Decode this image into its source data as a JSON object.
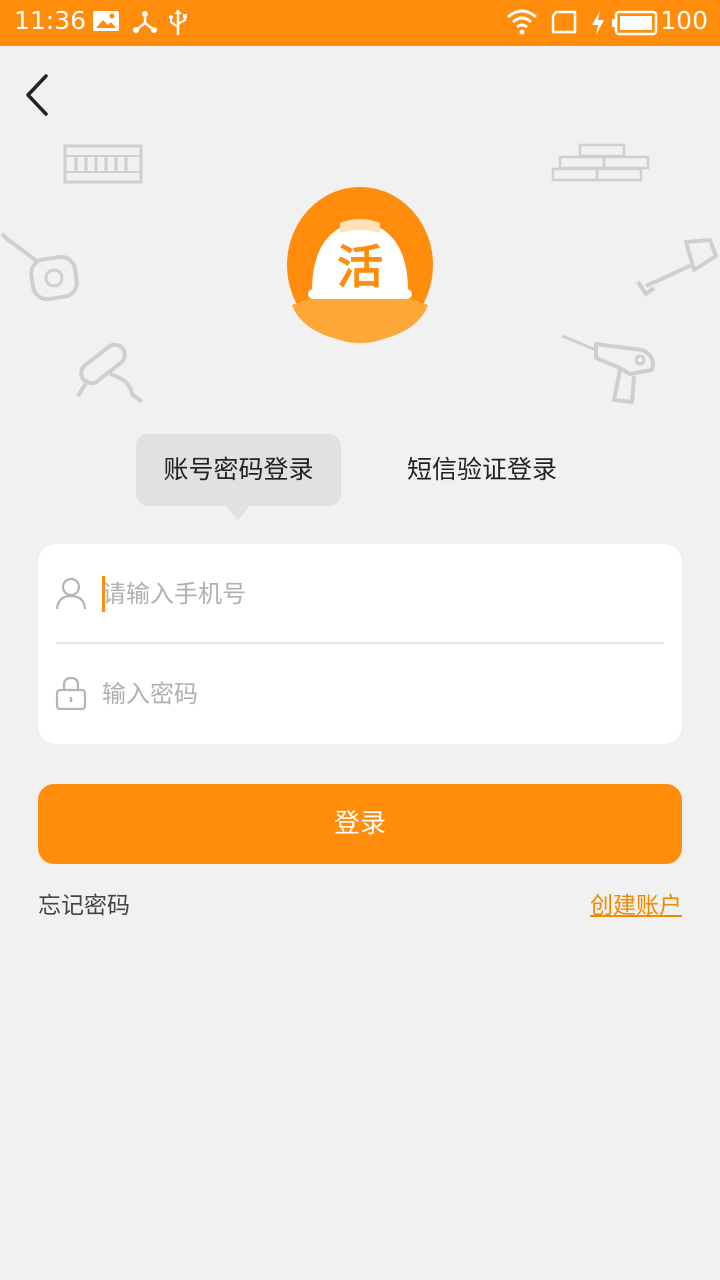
{
  "status_bar": {
    "time": "11:36",
    "battery_level": "100",
    "icons": [
      "image-icon",
      "share-icon",
      "usb-icon",
      "wifi-icon",
      "sim-icon",
      "charging-icon",
      "battery-icon"
    ]
  },
  "header": {
    "back_icon": "chevron-left-icon"
  },
  "logo": {
    "char": "活"
  },
  "tabs": [
    {
      "label": "账号密码登录",
      "active": true
    },
    {
      "label": "短信验证登录",
      "active": false
    }
  ],
  "form": {
    "phone": {
      "placeholder": "请输入手机号",
      "value": "",
      "icon": "user-icon"
    },
    "password": {
      "placeholder": "输入密码",
      "value": "",
      "icon": "lock-icon"
    }
  },
  "actions": {
    "login_label": "登录",
    "forgot_label": "忘记密码",
    "create_label": "创建账户"
  },
  "colors": {
    "accent": "#ff8c0a",
    "background": "#f1f1f1",
    "tab_active_bg": "#e1e1e1"
  }
}
